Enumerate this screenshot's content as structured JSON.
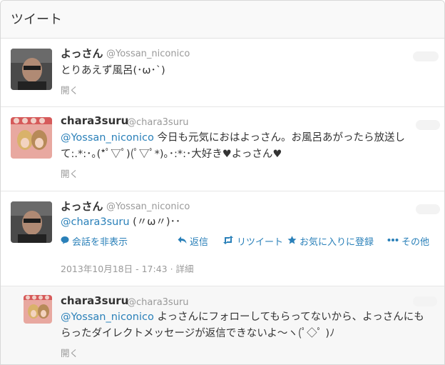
{
  "header": {
    "title": "ツイート"
  },
  "tweets": [
    {
      "name": "よっさん",
      "handle": "@Yossan_niconico",
      "line1": "とりあえず風呂(･ω･`)",
      "open": "開く"
    },
    {
      "name": "chara3suru",
      "handle": "@chara3suru",
      "mention": "@Yossan_niconico",
      "line1_rest": " 今日も元気におはよっさん。お風呂あがったら放送し",
      "line2": "て:.*:･｡(*ﾟ▽ﾟ)(ﾟ▽ﾟ*)｡･:*:･大好き♥よっさん♥",
      "open": "開く"
    },
    {
      "name": "よっさん",
      "handle": "@Yossan_niconico",
      "mention": "@chara3suru",
      "line1_rest": " (〃ω〃)･･",
      "actions": {
        "hide": "会話を非表示",
        "reply": "返信",
        "retweet": "リツイート",
        "favorite": "お気に入りに登録",
        "more": "その他"
      },
      "date": "2013年10月18日",
      "separator": " - ",
      "time": "17:43",
      "detail_sep": " · ",
      "detail": "詳細"
    },
    {
      "name": "chara3suru",
      "handle": "@chara3suru",
      "mention": "@Yossan_niconico",
      "line1_rest": " よっさんにフォローしてもらってないから、よっさんにも",
      "line2": "らったダイレクトメッセージが返信できないよ〜ヽ(ﾟ◇ﾟ )ﾉ",
      "open": "開く"
    }
  ],
  "colors": {
    "link": "#2a80b9",
    "muted": "#999999",
    "text": "#333333"
  }
}
